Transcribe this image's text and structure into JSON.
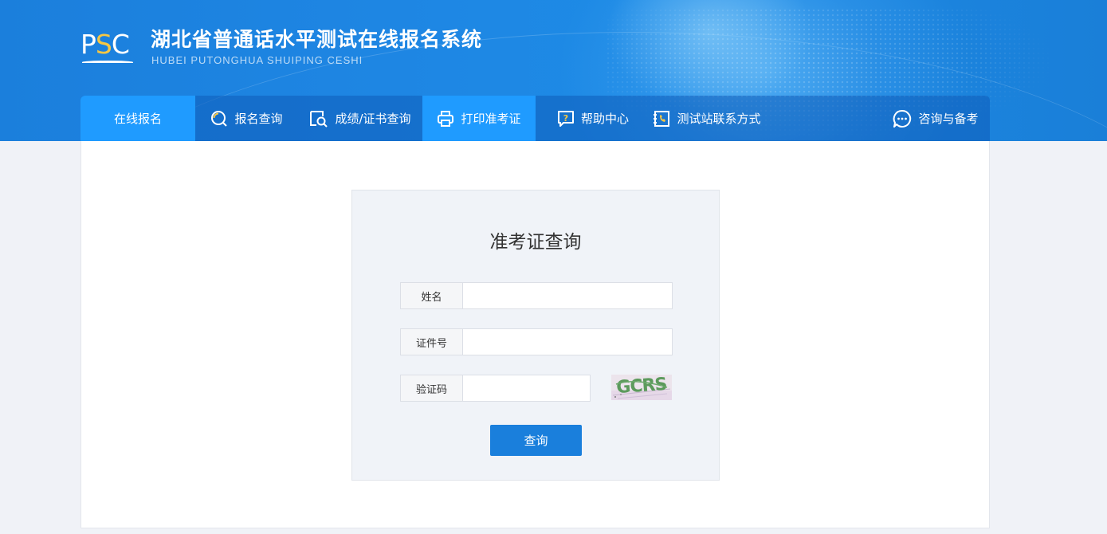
{
  "header": {
    "logo_text": "PSC",
    "title_cn": "湖北省普通话水平测试在线报名系统",
    "title_en": "HUBEI PUTONGHUA SHUIPING CESHI"
  },
  "nav": {
    "items": [
      {
        "label": "在线报名",
        "icon": "none",
        "active": false
      },
      {
        "label": "报名查询",
        "icon": "search-icon",
        "active": false
      },
      {
        "label": "成绩/证书查询",
        "icon": "certificate-search-icon",
        "active": false
      },
      {
        "label": "打印准考证",
        "icon": "printer-icon",
        "active": true
      },
      {
        "label": "帮助中心",
        "icon": "help-icon",
        "active": false
      },
      {
        "label": "测试站联系方式",
        "icon": "phone-book-icon",
        "active": false
      },
      {
        "label": "咨询与备考",
        "icon": "chat-icon",
        "active": false
      }
    ],
    "active_color": "#1f9bff"
  },
  "form": {
    "title": "准考证查询",
    "name_label": "姓名",
    "name_value": "",
    "id_label": "证件号",
    "id_value": "",
    "captcha_label": "验证码",
    "captcha_value": "",
    "captcha_text": "GCRS",
    "submit_label": "查询"
  },
  "colors": {
    "header_blue": "#1e86e3",
    "button_blue": "#1a7fdc",
    "logo_accent": "#f6c744"
  }
}
